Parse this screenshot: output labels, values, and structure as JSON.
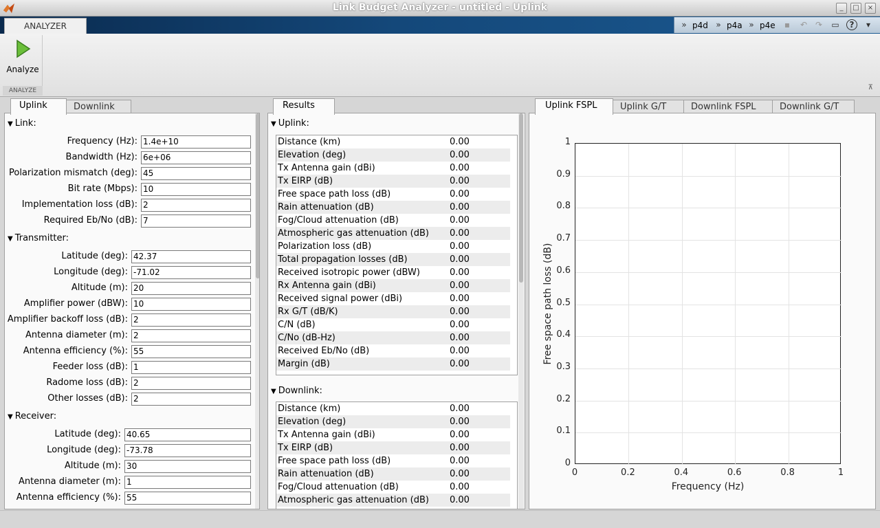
{
  "window": {
    "title": "Link Budget Analyzer - untitled - Uplink"
  },
  "toolstrip": {
    "tab": "ANALYZER",
    "quick_access": [
      "p4d",
      "p4a",
      "p4e"
    ],
    "analyze_label": "Analyze",
    "section_label": "ANALYZE"
  },
  "left": {
    "tabs": [
      "Uplink",
      "Downlink"
    ],
    "link": {
      "header": "Link:",
      "fields": [
        {
          "label": "Frequency (Hz):",
          "value": "1.4e+10"
        },
        {
          "label": "Bandwidth (Hz):",
          "value": "6e+06"
        },
        {
          "label": "Polarization mismatch (deg):",
          "value": "45"
        },
        {
          "label": "Bit rate (Mbps):",
          "value": "10"
        },
        {
          "label": "Implementation loss (dB):",
          "value": "2"
        },
        {
          "label": "Required Eb/No (dB):",
          "value": "7"
        }
      ]
    },
    "transmitter": {
      "header": "Transmitter:",
      "fields": [
        {
          "label": "Latitude (deg):",
          "value": "42.37"
        },
        {
          "label": "Longitude (deg):",
          "value": "-71.02"
        },
        {
          "label": "Altitude (m):",
          "value": "20"
        },
        {
          "label": "Amplifier power (dBW):",
          "value": "10"
        },
        {
          "label": "Amplifier backoff loss (dB):",
          "value": "2"
        },
        {
          "label": "Antenna diameter (m):",
          "value": "2"
        },
        {
          "label": "Antenna efficiency (%):",
          "value": "55"
        },
        {
          "label": "Feeder loss (dB):",
          "value": "1"
        },
        {
          "label": "Radome loss (dB):",
          "value": "2"
        },
        {
          "label": "Other losses (dB):",
          "value": "2"
        }
      ]
    },
    "receiver": {
      "header": "Receiver:",
      "fields": [
        {
          "label": "Latitude (deg):",
          "value": "40.65"
        },
        {
          "label": "Longitude (deg):",
          "value": "-73.78"
        },
        {
          "label": "Altitude (m):",
          "value": "30"
        },
        {
          "label": "Antenna diameter (m):",
          "value": "1"
        },
        {
          "label": "Antenna efficiency (%):",
          "value": "55"
        }
      ]
    }
  },
  "results": {
    "tab": "Results",
    "uplink": {
      "header": "Uplink:",
      "rows": [
        {
          "name": "Distance (km)",
          "value": "0.00"
        },
        {
          "name": "Elevation (deg)",
          "value": "0.00"
        },
        {
          "name": "Tx Antenna gain (dBi)",
          "value": "0.00"
        },
        {
          "name": "Tx EIRP (dB)",
          "value": "0.00"
        },
        {
          "name": "Free space path loss (dB)",
          "value": "0.00"
        },
        {
          "name": "Rain attenuation (dB)",
          "value": "0.00"
        },
        {
          "name": "Fog/Cloud attenuation (dB)",
          "value": "0.00"
        },
        {
          "name": "Atmospheric gas attenuation (dB)",
          "value": "0.00"
        },
        {
          "name": "Polarization loss (dB)",
          "value": "0.00"
        },
        {
          "name": "Total propagation losses (dB)",
          "value": "0.00"
        },
        {
          "name": "Received isotropic power (dBW)",
          "value": "0.00"
        },
        {
          "name": "Rx Antenna gain (dBi)",
          "value": "0.00"
        },
        {
          "name": "Received signal power (dBi)",
          "value": "0.00"
        },
        {
          "name": "Rx G/T (dB/K)",
          "value": "0.00"
        },
        {
          "name": "C/N (dB)",
          "value": "0.00"
        },
        {
          "name": "C/No (dB-Hz)",
          "value": "0.00"
        },
        {
          "name": "Received Eb/No (dB)",
          "value": "0.00"
        },
        {
          "name": "Margin (dB)",
          "value": "0.00"
        }
      ]
    },
    "downlink": {
      "header": "Downlink:",
      "rows": [
        {
          "name": "Distance (km)",
          "value": "0.00"
        },
        {
          "name": "Elevation (deg)",
          "value": "0.00"
        },
        {
          "name": "Tx Antenna gain (dBi)",
          "value": "0.00"
        },
        {
          "name": "Tx EIRP (dB)",
          "value": "0.00"
        },
        {
          "name": "Free space path loss (dB)",
          "value": "0.00"
        },
        {
          "name": "Rain attenuation (dB)",
          "value": "0.00"
        },
        {
          "name": "Fog/Cloud attenuation (dB)",
          "value": "0.00"
        },
        {
          "name": "Atmospheric gas attenuation (dB)",
          "value": "0.00"
        }
      ]
    }
  },
  "plot": {
    "tabs": [
      "Uplink FSPL",
      "Uplink G/T",
      "Downlink FSPL",
      "Downlink G/T"
    ]
  },
  "chart_data": {
    "type": "line",
    "title": "",
    "xlabel": "Frequency (Hz)",
    "ylabel": "Free space path loss (dB)",
    "xlim": [
      0,
      1
    ],
    "ylim": [
      0,
      1
    ],
    "xticks": [
      "0",
      "0.2",
      "0.4",
      "0.6",
      "0.8",
      "1"
    ],
    "yticks": [
      "0",
      "0.1",
      "0.2",
      "0.3",
      "0.4",
      "0.5",
      "0.6",
      "0.7",
      "0.8",
      "0.9",
      "1"
    ],
    "grid": true,
    "series": []
  }
}
